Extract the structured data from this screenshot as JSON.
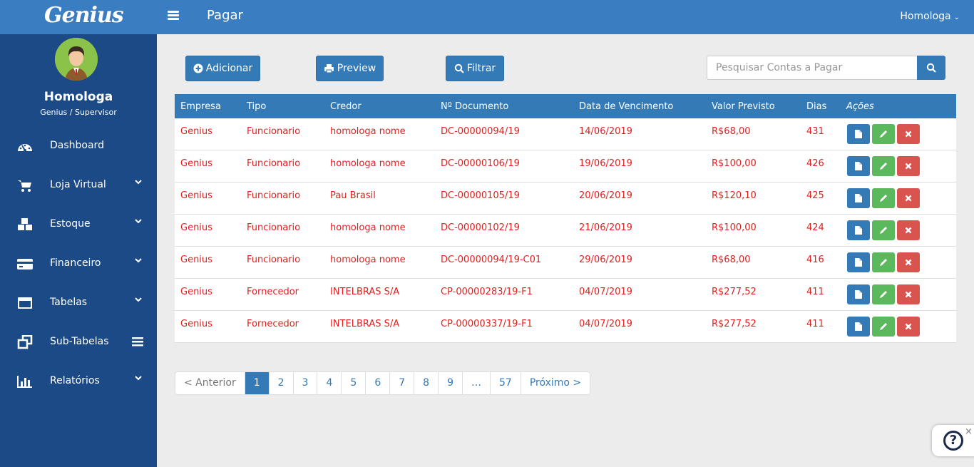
{
  "app": {
    "logo": "Genius",
    "page_title": "Pagar",
    "user": "Homologa"
  },
  "profile": {
    "name": "Homologa",
    "role": "Genius / Supervisor"
  },
  "nav": [
    {
      "label": "Dashboard",
      "icon": "dashboard-icon",
      "trailing": "none"
    },
    {
      "label": "Loja Virtual",
      "icon": "cart-icon",
      "trailing": "chevron"
    },
    {
      "label": "Estoque",
      "icon": "cubes-icon",
      "trailing": "chevron"
    },
    {
      "label": "Financeiro",
      "icon": "credit-card-icon",
      "trailing": "chevron"
    },
    {
      "label": "Tabelas",
      "icon": "window-icon",
      "trailing": "chevron"
    },
    {
      "label": "Sub-Tabelas",
      "icon": "clone-icon",
      "trailing": "menu"
    },
    {
      "label": "Relatórios",
      "icon": "bar-chart-icon",
      "trailing": "chevron"
    }
  ],
  "toolbar": {
    "add_label": "Adicionar",
    "preview_label": "Preview",
    "filter_label": "Filtrar",
    "search_placeholder": "Pesquisar Contas a Pagar"
  },
  "table": {
    "headers": [
      "Empresa",
      "Tipo",
      "Credor",
      "Nº Documento",
      "Data de Vencimento",
      "Valor Previsto",
      "Dias",
      "Ações"
    ],
    "rows": [
      [
        "Genius",
        "Funcionario",
        "homologa nome",
        "DC-00000094/19",
        "14/06/2019",
        "R$68,00",
        "431"
      ],
      [
        "Genius",
        "Funcionario",
        "homologa nome",
        "DC-00000106/19",
        "19/06/2019",
        "R$100,00",
        "426"
      ],
      [
        "Genius",
        "Funcionario",
        "Pau Brasil",
        "DC-00000105/19",
        "20/06/2019",
        "R$120,10",
        "425"
      ],
      [
        "Genius",
        "Funcionario",
        "homologa nome",
        "DC-00000102/19",
        "21/06/2019",
        "R$100,00",
        "424"
      ],
      [
        "Genius",
        "Funcionario",
        "homologa nome",
        "DC-00000094/19-C01",
        "29/06/2019",
        "R$68,00",
        "416"
      ],
      [
        "Genius",
        "Fornecedor",
        "INTELBRAS S/A",
        "CP-00000283/19-F1",
        "04/07/2019",
        "R$277,52",
        "411"
      ],
      [
        "Genius",
        "Fornecedor",
        "INTELBRAS S/A",
        "CP-00000337/19-F1",
        "04/07/2019",
        "R$277,52",
        "411"
      ]
    ]
  },
  "pagination": {
    "prev": "< Anterior",
    "pages": [
      "1",
      "2",
      "3",
      "4",
      "5",
      "6",
      "7",
      "8",
      "9",
      "…",
      "57"
    ],
    "active": "1",
    "next": "Próximo >"
  },
  "help": {
    "symbol": "?",
    "close": "×"
  },
  "colors": {
    "topbar": "#3a7ec1",
    "sidebar": "#1b4a87",
    "primary": "#337ab7",
    "success": "#5cb85c",
    "danger": "#d9534f",
    "row_text": "#e32020"
  }
}
